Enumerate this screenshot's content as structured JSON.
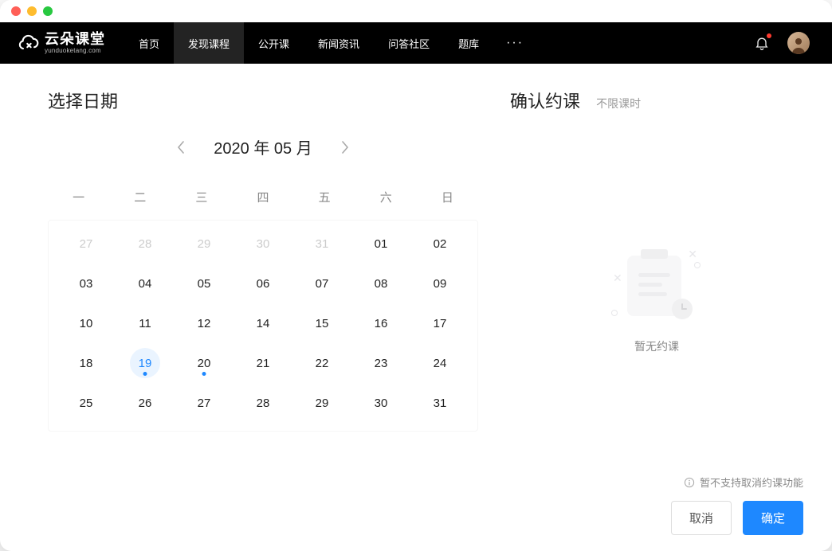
{
  "logo": {
    "name": "云朵课堂",
    "sub": "yunduoketang.com"
  },
  "nav": {
    "items": [
      "首页",
      "发现课程",
      "公开课",
      "新闻资讯",
      "问答社区",
      "题库"
    ],
    "active_index": 1
  },
  "left": {
    "title": "选择日期",
    "month_label": "2020 年 05 月",
    "weekdays": [
      "一",
      "二",
      "三",
      "四",
      "五",
      "六",
      "日"
    ],
    "weeks": [
      [
        {
          "d": "27",
          "dim": true
        },
        {
          "d": "28",
          "dim": true
        },
        {
          "d": "29",
          "dim": true
        },
        {
          "d": "30",
          "dim": true
        },
        {
          "d": "31",
          "dim": true
        },
        {
          "d": "01"
        },
        {
          "d": "02"
        }
      ],
      [
        {
          "d": "03"
        },
        {
          "d": "04"
        },
        {
          "d": "05"
        },
        {
          "d": "06"
        },
        {
          "d": "07"
        },
        {
          "d": "08"
        },
        {
          "d": "09"
        }
      ],
      [
        {
          "d": "10"
        },
        {
          "d": "11"
        },
        {
          "d": "12"
        },
        {
          "d": "14"
        },
        {
          "d": "15"
        },
        {
          "d": "16"
        },
        {
          "d": "17"
        }
      ],
      [
        {
          "d": "18"
        },
        {
          "d": "19",
          "today": true,
          "dot": true
        },
        {
          "d": "20",
          "dot": true
        },
        {
          "d": "21"
        },
        {
          "d": "22"
        },
        {
          "d": "23"
        },
        {
          "d": "24"
        }
      ],
      [
        {
          "d": "25"
        },
        {
          "d": "26"
        },
        {
          "d": "27"
        },
        {
          "d": "28"
        },
        {
          "d": "29"
        },
        {
          "d": "30"
        },
        {
          "d": "31"
        }
      ]
    ]
  },
  "right": {
    "title": "确认约课",
    "subtitle": "不限课时",
    "empty_text": "暂无约课",
    "note": "暂不支持取消约课功能",
    "cancel": "取消",
    "ok": "确定"
  },
  "colors": {
    "accent": "#1e88ff"
  }
}
